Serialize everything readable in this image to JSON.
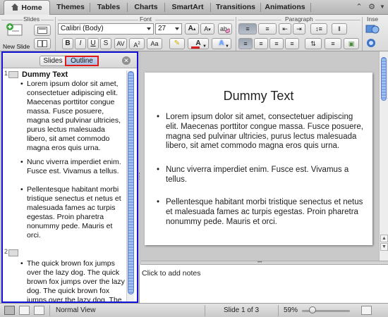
{
  "tabs": {
    "items": [
      "Home",
      "Themes",
      "Tables",
      "Charts",
      "SmartArt",
      "Transitions",
      "Animations"
    ],
    "active_index": 0
  },
  "ribbon": {
    "groups": {
      "slides": "Slides",
      "font": "Font",
      "paragraph": "Paragraph",
      "insert": "Inse"
    },
    "new_slide_label": "New Slide",
    "font_name": "Calibri (Body)",
    "font_size": "27",
    "bold": "B",
    "italic": "I",
    "underline": "U",
    "strike": "S",
    "grow_font": "A",
    "shrink_font": "A",
    "font_color_letter": "A",
    "font_color": "#d81c1c",
    "highlight_letter": "A"
  },
  "left_panel": {
    "tab_slides": "Slides",
    "tab_outline": "Outline",
    "active_tab": "Outline",
    "outline": [
      {
        "number": "1",
        "title": "Dummy Text",
        "bullets": [
          "Lorem ipsum dolor sit amet, consectetuer adipiscing elit. Maecenas porttitor congue massa. Fusce posuere, magna sed pulvinar ultricies, purus lectus malesuada libero, sit amet commodo magna eros quis urna.",
          "Nunc viverra imperdiet enim. Fusce est. Vivamus a tellus.",
          "Pellentesque habitant morbi tristique senectus et netus et malesuada fames ac turpis egestas. Proin pharetra nonummy pede. Mauris et orci."
        ]
      },
      {
        "number": "2",
        "title": "",
        "bullets": [
          "The quick brown fox jumps over the lazy dog. The quick brown fox jumps over the lazy dog. The quick brown fox jumps over the lazy dog. The"
        ]
      }
    ]
  },
  "slide": {
    "title": "Dummy Text",
    "bullets": [
      "Lorem ipsum dolor sit amet, consectetuer adipiscing elit. Maecenas porttitor congue massa. Fusce posuere, magna sed pulvinar ultricies, purus lectus malesuada libero, sit amet commodo magna eros quis urna.",
      "Nunc viverra imperdiet enim. Fusce est. Vivamus a tellus.",
      "Pellentesque habitant morbi tristique senectus et netus et malesuada fames ac turpis egestas. Proin pharetra nonummy pede. Mauris et orci."
    ]
  },
  "notes": {
    "placeholder": "Click to add notes"
  },
  "status": {
    "view_name": "Normal View",
    "slide_position": "Slide 1 of 3",
    "zoom": "59%"
  },
  "colors": {
    "accent_blue_border": "#1414d8",
    "outline_tab_highlight": "#e01818",
    "scroll_thumb": "#7ea4e6"
  }
}
